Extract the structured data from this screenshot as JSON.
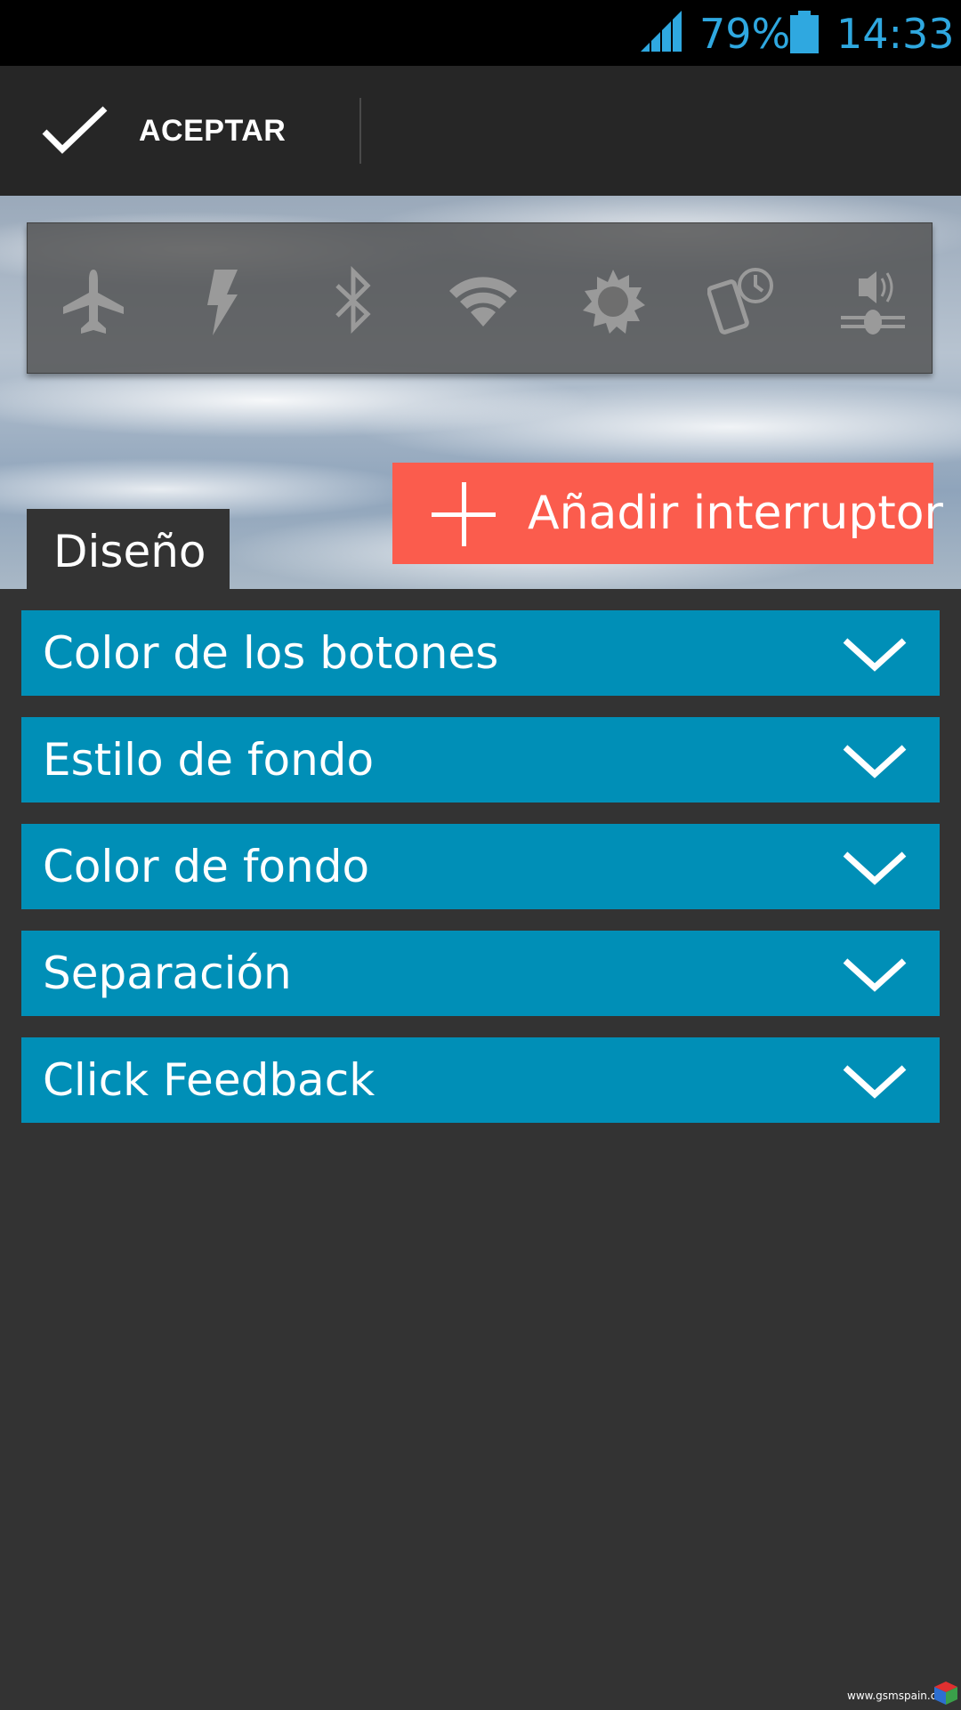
{
  "status_bar": {
    "battery_percent": "79%",
    "clock": "14:33",
    "icons": [
      "signal-icon",
      "battery-icon"
    ],
    "color": "#2fa8e0"
  },
  "action_bar": {
    "accept_label": "ACEPTAR",
    "icons": [
      "check-icon"
    ]
  },
  "preview": {
    "toggles": [
      {
        "name": "airplane-mode-icon"
      },
      {
        "name": "flashlight-icon"
      },
      {
        "name": "bluetooth-icon"
      },
      {
        "name": "wifi-icon"
      },
      {
        "name": "brightness-icon"
      },
      {
        "name": "screen-timeout-icon"
      },
      {
        "name": "sound-mode-icon"
      }
    ],
    "add_switch_label": "Añadir interruptor",
    "add_switch_color": "#fb5c4d",
    "design_tab_label": "Diseño"
  },
  "settings": {
    "accent": "#008fb7",
    "items": [
      {
        "label": "Color de los botones"
      },
      {
        "label": "Estilo de fondo"
      },
      {
        "label": "Color de fondo"
      },
      {
        "label": "Separación"
      },
      {
        "label": "Click Feedback"
      }
    ]
  },
  "watermark": {
    "text": "www.gsmspain.com"
  }
}
